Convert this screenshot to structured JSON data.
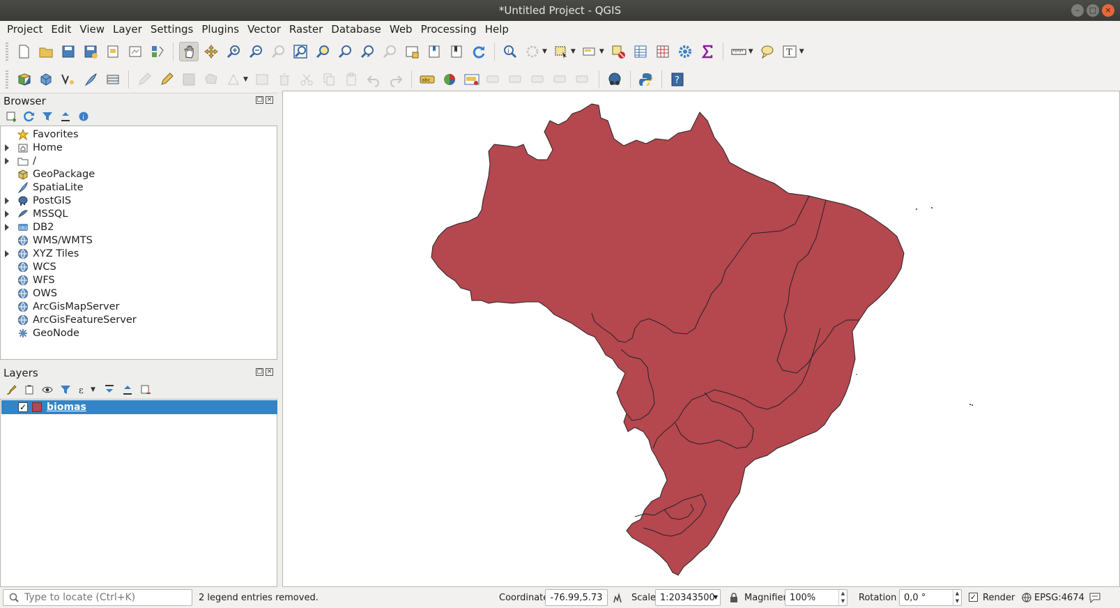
{
  "window": {
    "title": "*Untitled Project - QGIS",
    "buttons": [
      "–",
      "□",
      "×"
    ]
  },
  "menu": [
    "Project",
    "Edit",
    "View",
    "Layer",
    "Settings",
    "Plugins",
    "Vector",
    "Raster",
    "Database",
    "Web",
    "Processing",
    "Help"
  ],
  "browser": {
    "title": "Browser",
    "items": [
      {
        "label": "Favorites",
        "icon": "star-icon",
        "expandable": false
      },
      {
        "label": "Home",
        "icon": "home-folder-icon",
        "expandable": true
      },
      {
        "label": "/",
        "icon": "folder-icon",
        "expandable": true
      },
      {
        "label": "GeoPackage",
        "icon": "geopackage-icon",
        "expandable": false
      },
      {
        "label": "SpatiaLite",
        "icon": "spatialite-icon",
        "expandable": false
      },
      {
        "label": "PostGIS",
        "icon": "postgis-elephant-icon",
        "expandable": true
      },
      {
        "label": "MSSQL",
        "icon": "mssql-icon",
        "expandable": true
      },
      {
        "label": "DB2",
        "icon": "db2-icon",
        "expandable": true
      },
      {
        "label": "WMS/WMTS",
        "icon": "globe-icon",
        "expandable": false
      },
      {
        "label": "XYZ Tiles",
        "icon": "globe-icon",
        "expandable": true
      },
      {
        "label": "WCS",
        "icon": "globe-icon",
        "expandable": false
      },
      {
        "label": "WFS",
        "icon": "globe-icon",
        "expandable": false
      },
      {
        "label": "OWS",
        "icon": "globe-icon",
        "expandable": false
      },
      {
        "label": "ArcGisMapServer",
        "icon": "globe-icon",
        "expandable": false
      },
      {
        "label": "ArcGisFeatureServer",
        "icon": "globe-icon",
        "expandable": false
      },
      {
        "label": "GeoNode",
        "icon": "geonode-icon",
        "expandable": false
      }
    ]
  },
  "layers": {
    "title": "Layers",
    "items": [
      {
        "name": "biomas",
        "checked": true,
        "color": "#b5474f"
      }
    ]
  },
  "map": {
    "fill_color": "#b5474f",
    "stroke_color": "#232323"
  },
  "status": {
    "locator_placeholder": "Type to locate (Ctrl+K)",
    "message": "2 legend entries removed.",
    "coordinate_label": "Coordinate",
    "coordinate_value": "-76.99,5.73",
    "scale_label": "Scale",
    "scale_value": "1:20343500",
    "magnifier_label": "Magnifier",
    "magnifier_value": "100%",
    "rotation_label": "Rotation",
    "rotation_value": "0,0 °",
    "render_label": "Render",
    "render_checked": true,
    "crs": "EPSG:4674"
  }
}
